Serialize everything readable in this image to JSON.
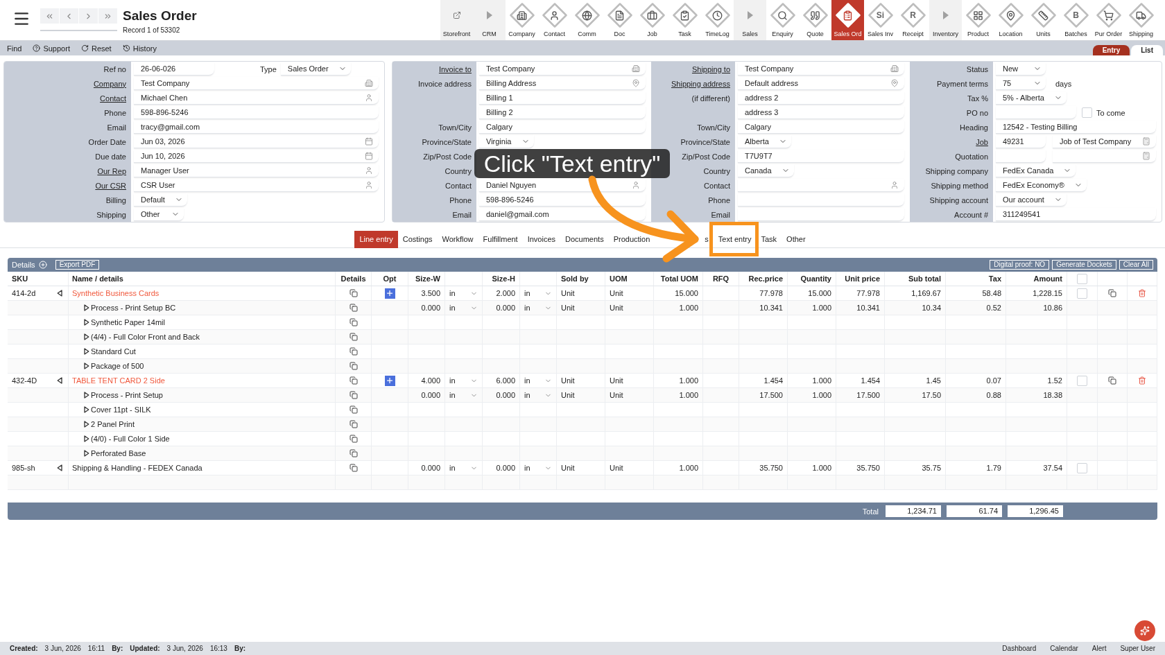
{
  "header": {
    "title": "Sales Order",
    "record": "Record 1 of 53302"
  },
  "toolbar": [
    {
      "label": "Storefront",
      "kind": "link",
      "selected": false
    },
    {
      "label": "CRM",
      "kind": "section",
      "selected": false
    },
    {
      "label": "Company",
      "kind": "app",
      "selected": false
    },
    {
      "label": "Contact",
      "kind": "app",
      "selected": false
    },
    {
      "label": "Comm",
      "kind": "app",
      "selected": false
    },
    {
      "label": "Doc",
      "kind": "app",
      "selected": false
    },
    {
      "label": "Job",
      "kind": "app",
      "selected": false
    },
    {
      "label": "Task",
      "kind": "app",
      "selected": false
    },
    {
      "label": "TimeLog",
      "kind": "app",
      "selected": false
    },
    {
      "label": "Sales",
      "kind": "section",
      "selected": false
    },
    {
      "label": "Enquiry",
      "kind": "app",
      "selected": false
    },
    {
      "label": "Quote",
      "kind": "app",
      "selected": false
    },
    {
      "label": "Sales Ord",
      "kind": "app",
      "selected": true
    },
    {
      "label": "Sales Inv",
      "kind": "app",
      "glyph": "Si",
      "selected": false
    },
    {
      "label": "Receipt",
      "kind": "app",
      "glyph": "R",
      "selected": false
    },
    {
      "label": "Inventory",
      "kind": "section",
      "selected": false
    },
    {
      "label": "Product",
      "kind": "app",
      "selected": false
    },
    {
      "label": "Location",
      "kind": "app",
      "selected": false
    },
    {
      "label": "Units",
      "kind": "app",
      "selected": false
    },
    {
      "label": "Batches",
      "kind": "app",
      "glyph": "B",
      "selected": false
    },
    {
      "label": "Pur Order",
      "kind": "app",
      "selected": false
    },
    {
      "label": "Shipping",
      "kind": "app",
      "selected": false
    }
  ],
  "actions": [
    "Find",
    "Support",
    "Reset",
    "History"
  ],
  "view_tabs": [
    {
      "label": "Entry",
      "selected": true
    },
    {
      "label": "List",
      "selected": false
    }
  ],
  "form": {
    "main": [
      {
        "label": "Ref no",
        "link": false,
        "kind": "short",
        "value": "26-06-026",
        "extra": {
          "label": "Type",
          "kind": "select",
          "value": "Sales Order"
        }
      },
      {
        "label": "Company",
        "link": true,
        "kind": "company",
        "value": "Test Company"
      },
      {
        "label": "Contact",
        "link": true,
        "kind": "person",
        "value": "Michael Chen"
      },
      {
        "label": "Phone",
        "link": false,
        "kind": "text",
        "value": "598-896-5246"
      },
      {
        "label": "Email",
        "link": false,
        "kind": "text",
        "value": "tracy@gmail.com"
      },
      {
        "label": "Order Date",
        "link": false,
        "kind": "date",
        "value": "Jun 03, 2026"
      },
      {
        "label": "Due date",
        "link": false,
        "kind": "date",
        "value": "Jun 10, 2026"
      },
      {
        "label": "Our Rep",
        "link": true,
        "kind": "person",
        "value": "Manager User"
      },
      {
        "label": "Our CSR",
        "link": true,
        "kind": "person",
        "value": "CSR User"
      },
      {
        "label": "Billing",
        "link": false,
        "kind": "select",
        "value": "Default"
      },
      {
        "label": "Shipping",
        "link": false,
        "kind": "select",
        "value": "Other"
      }
    ],
    "invoice": [
      {
        "label": "Invoice to",
        "link": true,
        "kind": "company",
        "value": "Test Company"
      },
      {
        "label": "Invoice address",
        "link": false,
        "kind": "address",
        "value": "Billing Address"
      },
      {
        "kind": "text",
        "value": "Billing 1"
      },
      {
        "kind": "text",
        "value": "Billing 2"
      },
      {
        "label": "Town/City",
        "link": false,
        "kind": "text",
        "value": "Calgary"
      },
      {
        "label": "Province/State",
        "link": false,
        "kind": "select",
        "value": "Virginia"
      },
      {
        "label": "Zip/Post Code",
        "link": false
      },
      {
        "label": "Country",
        "link": false
      },
      {
        "label": "Contact",
        "link": false,
        "kind": "person",
        "value": "Daniel Nguyen"
      },
      {
        "label": "Phone",
        "link": false,
        "kind": "text",
        "value": "598-896-5246"
      },
      {
        "label": "Email",
        "link": false,
        "kind": "text",
        "value": "daniel@gmail.com"
      }
    ],
    "shipping": [
      {
        "label": "Shipping to",
        "link": true,
        "kind": "company",
        "value": "Test Company"
      },
      {
        "label": "Shipping address",
        "link": true,
        "kind": "address",
        "value": "Default address"
      },
      {
        "label": "(if different)",
        "link": false,
        "kind": "text",
        "value": "address 2"
      },
      {
        "kind": "text",
        "value": "address 3"
      },
      {
        "label": "Town/City",
        "link": false,
        "kind": "text",
        "value": "Calgary"
      },
      {
        "label": "Province/State",
        "link": false,
        "kind": "select",
        "value": "Alberta"
      },
      {
        "label": "Zip/Post Code",
        "link": false,
        "kind": "text",
        "value": "T7U9T7"
      },
      {
        "label": "Country",
        "link": false,
        "kind": "select",
        "value": "Canada"
      },
      {
        "label": "Contact",
        "link": false,
        "kind": "person"
      },
      {
        "label": "Phone",
        "link": false,
        "kind": "text"
      },
      {
        "label": "Email",
        "link": false,
        "kind": "text"
      }
    ],
    "status": [
      {
        "label": "Status",
        "link": false,
        "kind": "select",
        "value": "New"
      },
      {
        "label": "Payment terms",
        "link": false,
        "kind": "select",
        "value": "75",
        "suffix": "days"
      },
      {
        "label": "Tax %",
        "link": false,
        "kind": "select",
        "value": "5% - Alberta"
      },
      {
        "label": "PO no",
        "link": false,
        "kind": "short",
        "checkbox": {
          "label": "To come",
          "checked": false
        }
      },
      {
        "label": "Heading",
        "link": false,
        "kind": "text",
        "value": "12542 - Testing Billing"
      },
      {
        "label": "Job",
        "link": true,
        "kind": "number",
        "value": "49231",
        "extra": {
          "kind": "calc",
          "value": "Job of Test Company"
        }
      },
      {
        "label": "Quotation",
        "link": false,
        "kind": "number",
        "extra": {
          "kind": "calc"
        }
      },
      {
        "label": "Shipping company",
        "link": false,
        "kind": "select",
        "value": "FedEx Canada"
      },
      {
        "label": "Shipping method",
        "link": false,
        "kind": "select",
        "value": "FedEx Economy®"
      },
      {
        "label": "Shipping account",
        "link": false,
        "kind": "select",
        "value": "Our account"
      },
      {
        "label": "Account #",
        "link": false,
        "kind": "text",
        "value": "311249541"
      }
    ]
  },
  "callout": {
    "text": "Click \"Text entry\""
  },
  "tabs": [
    {
      "label": "Line entry",
      "kind": "tab",
      "selected": true,
      "highlighted": false
    },
    {
      "label": "Costings",
      "kind": "tab",
      "selected": false,
      "highlighted": false
    },
    {
      "label": "Workflow",
      "kind": "tab",
      "selected": false,
      "highlighted": false
    },
    {
      "label": "Fulfillment",
      "kind": "tab",
      "selected": false,
      "highlighted": false
    },
    {
      "label": "Invoices",
      "kind": "tab",
      "selected": false,
      "highlighted": false
    },
    {
      "label": "Documents",
      "kind": "tab",
      "selected": false,
      "highlighted": false
    },
    {
      "label": "Production",
      "kind": "tab",
      "selected": false,
      "highlighted": false
    },
    {
      "label": "s",
      "kind": "partial",
      "selected": false,
      "highlighted": false
    },
    {
      "label": "Text entry",
      "kind": "tab",
      "selected": false,
      "highlighted": true
    },
    {
      "label": "Task",
      "kind": "tab",
      "selected": false,
      "highlighted": false
    },
    {
      "label": "Other",
      "kind": "tab",
      "selected": false,
      "highlighted": false
    }
  ],
  "table": {
    "title": "Details",
    "left_buttons": [
      "Export PDF"
    ],
    "right_buttons": [
      "Digital proof: NO",
      "Generate Dockets",
      "Clear All"
    ],
    "columns": [
      "SKU",
      "Name / details",
      "Details",
      "Opt",
      "Size-W",
      "Size-H",
      "Sold by",
      "UOM",
      "Total UOM",
      "RFQ",
      "Rec.price",
      "Quantity",
      "Unit price",
      "Sub total",
      "Tax",
      "Amount"
    ],
    "select_all_checked": false,
    "rows": [
      {
        "sku": "414-2d",
        "kind": "product",
        "expanded": true,
        "name": "Synthetic Business Cards",
        "color": "#f0583c",
        "size_w": "3.500",
        "size_w_unit": "in",
        "size_h": "2.000",
        "size_h_unit": "in",
        "sold_by": "Unit",
        "uom": "Unit",
        "total_uom": "15.000",
        "rec_price": "77.978",
        "quantity": "15.000",
        "unit_price": "77.978",
        "sub_total": "1,169.67",
        "tax": "58.48",
        "amount": "1,228.15",
        "checked": false,
        "children": [
          {
            "name": "Process - Print Setup BC",
            "expanded": false,
            "size_w": "0.000",
            "size_w_unit": "in",
            "size_h": "0.000",
            "size_h_unit": "in",
            "sold_by": "Unit",
            "uom": "Unit",
            "total_uom": "1.000",
            "rec_price": "10.341",
            "quantity": "1.000",
            "unit_price": "10.341",
            "sub_total": "10.34",
            "tax": "0.52",
            "amount": "10.86"
          },
          {
            "name": "Synthetic Paper 14mil",
            "expanded": false
          },
          {
            "name": "(4/4) - Full Color Front and Back",
            "expanded": false
          },
          {
            "name": "Standard Cut",
            "expanded": false
          },
          {
            "name": "Package of 500",
            "expanded": false
          }
        ]
      },
      {
        "sku": "432-4D",
        "kind": "product",
        "expanded": true,
        "name": "TABLE TENT CARD 2 Side",
        "color": "#f0583c",
        "size_w": "4.000",
        "size_w_unit": "in",
        "size_h": "6.000",
        "size_h_unit": "in",
        "sold_by": "Unit",
        "uom": "Unit",
        "total_uom": "1.000",
        "rec_price": "1.454",
        "quantity": "1.000",
        "unit_price": "1.454",
        "sub_total": "1.45",
        "tax": "0.07",
        "amount": "1.52",
        "checked": false,
        "children": [
          {
            "name": "Process - Print Setup",
            "expanded": false,
            "size_w": "0.000",
            "size_w_unit": "in",
            "size_h": "0.000",
            "size_h_unit": "in",
            "sold_by": "Unit",
            "uom": "Unit",
            "total_uom": "1.000",
            "rec_price": "17.500",
            "quantity": "1.000",
            "unit_price": "17.500",
            "sub_total": "17.50",
            "tax": "0.88",
            "amount": "18.38"
          },
          {
            "name": "Cover 11pt - SILK",
            "expanded": false
          },
          {
            "name": "2 Panel Print",
            "expanded": false
          },
          {
            "name": "(4/0) - Full Color 1 Side",
            "expanded": false
          },
          {
            "name": "Perforated Base",
            "expanded": false
          }
        ]
      },
      {
        "sku": "985-sh",
        "kind": "shipping",
        "expanded": true,
        "name": "Shipping & Handling - FEDEX Canada",
        "color": "#222222",
        "size_w": "0.000",
        "size_w_unit": "in",
        "size_h": "0.000",
        "size_h_unit": "in",
        "sold_by": "Unit",
        "uom": "Unit",
        "total_uom": "1.000",
        "rec_price": "35.750",
        "quantity": "1.000",
        "unit_price": "35.750",
        "sub_total": "35.75",
        "tax": "1.79",
        "amount": "37.54",
        "checked": false
      }
    ],
    "totals": {
      "label": "Total",
      "values": [
        "1,234.71",
        "61.74",
        "1,296.45"
      ]
    }
  },
  "status_bar": {
    "left": [
      {
        "kind": "label",
        "text": "Created:"
      },
      {
        "kind": "value",
        "text": "3 Jun, 2026"
      },
      {
        "kind": "value",
        "text": "16:11"
      },
      {
        "kind": "label",
        "text": "By:"
      },
      {
        "kind": "label",
        "text": "Updated:"
      },
      {
        "kind": "value",
        "text": "3 Jun, 2026"
      },
      {
        "kind": "value",
        "text": "16:13"
      },
      {
        "kind": "label",
        "text": "By:"
      }
    ],
    "right": [
      "Dashboard",
      "Calendar",
      "Alert",
      "Super User"
    ]
  }
}
